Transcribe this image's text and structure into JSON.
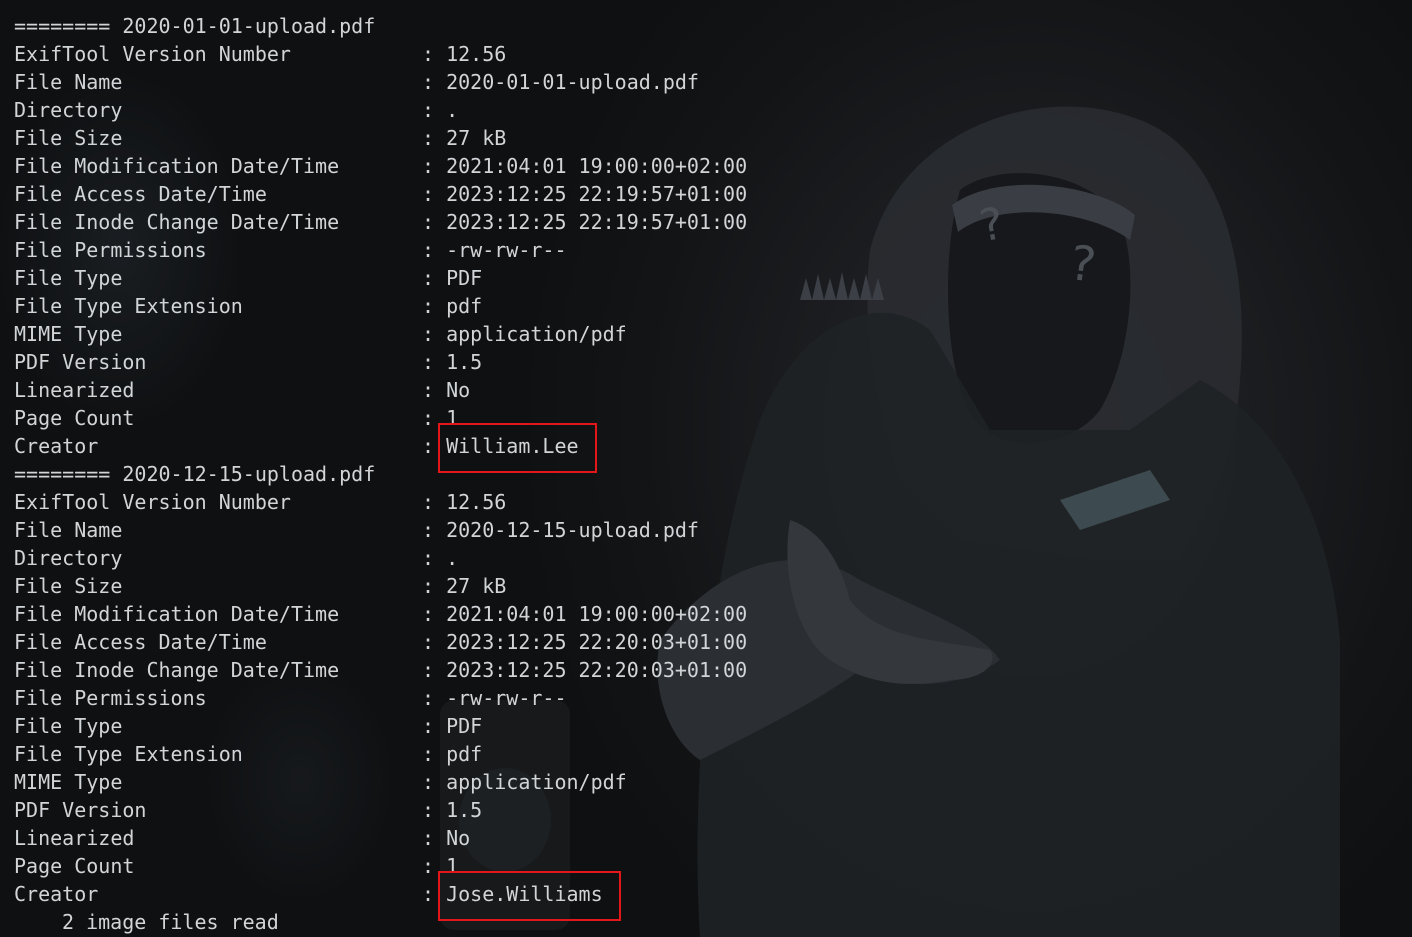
{
  "files": [
    {
      "header": "======== 2020-01-01-upload.pdf",
      "fields": [
        {
          "tag": "ExifTool Version Number",
          "value": "12.56"
        },
        {
          "tag": "File Name",
          "value": "2020-01-01-upload.pdf"
        },
        {
          "tag": "Directory",
          "value": "."
        },
        {
          "tag": "File Size",
          "value": "27 kB"
        },
        {
          "tag": "File Modification Date/Time",
          "value": "2021:04:01 19:00:00+02:00"
        },
        {
          "tag": "File Access Date/Time",
          "value": "2023:12:25 22:19:57+01:00"
        },
        {
          "tag": "File Inode Change Date/Time",
          "value": "2023:12:25 22:19:57+01:00"
        },
        {
          "tag": "File Permissions",
          "value": "-rw-rw-r--"
        },
        {
          "tag": "File Type",
          "value": "PDF"
        },
        {
          "tag": "File Type Extension",
          "value": "pdf"
        },
        {
          "tag": "MIME Type",
          "value": "application/pdf"
        },
        {
          "tag": "PDF Version",
          "value": "1.5"
        },
        {
          "tag": "Linearized",
          "value": "No"
        },
        {
          "tag": "Page Count",
          "value": "1"
        },
        {
          "tag": "Creator",
          "value": "William.Lee"
        }
      ]
    },
    {
      "header": "======== 2020-12-15-upload.pdf",
      "fields": [
        {
          "tag": "ExifTool Version Number",
          "value": "12.56"
        },
        {
          "tag": "File Name",
          "value": "2020-12-15-upload.pdf"
        },
        {
          "tag": "Directory",
          "value": "."
        },
        {
          "tag": "File Size",
          "value": "27 kB"
        },
        {
          "tag": "File Modification Date/Time",
          "value": "2021:04:01 19:00:00+02:00"
        },
        {
          "tag": "File Access Date/Time",
          "value": "2023:12:25 22:20:03+01:00"
        },
        {
          "tag": "File Inode Change Date/Time",
          "value": "2023:12:25 22:20:03+01:00"
        },
        {
          "tag": "File Permissions",
          "value": "-rw-rw-r--"
        },
        {
          "tag": "File Type",
          "value": "PDF"
        },
        {
          "tag": "File Type Extension",
          "value": "pdf"
        },
        {
          "tag": "MIME Type",
          "value": "application/pdf"
        },
        {
          "tag": "PDF Version",
          "value": "1.5"
        },
        {
          "tag": "Linearized",
          "value": "No"
        },
        {
          "tag": "Page Count",
          "value": "1"
        },
        {
          "tag": "Creator",
          "value": "Jose.Williams"
        }
      ]
    }
  ],
  "summary": "2 image files read",
  "colors": {
    "text": "#d2d5d7",
    "highlight_box": "#e3161a",
    "background": "#101214"
  },
  "icons": {
    "wallpaper": "masked-hacker-wallpaper"
  }
}
